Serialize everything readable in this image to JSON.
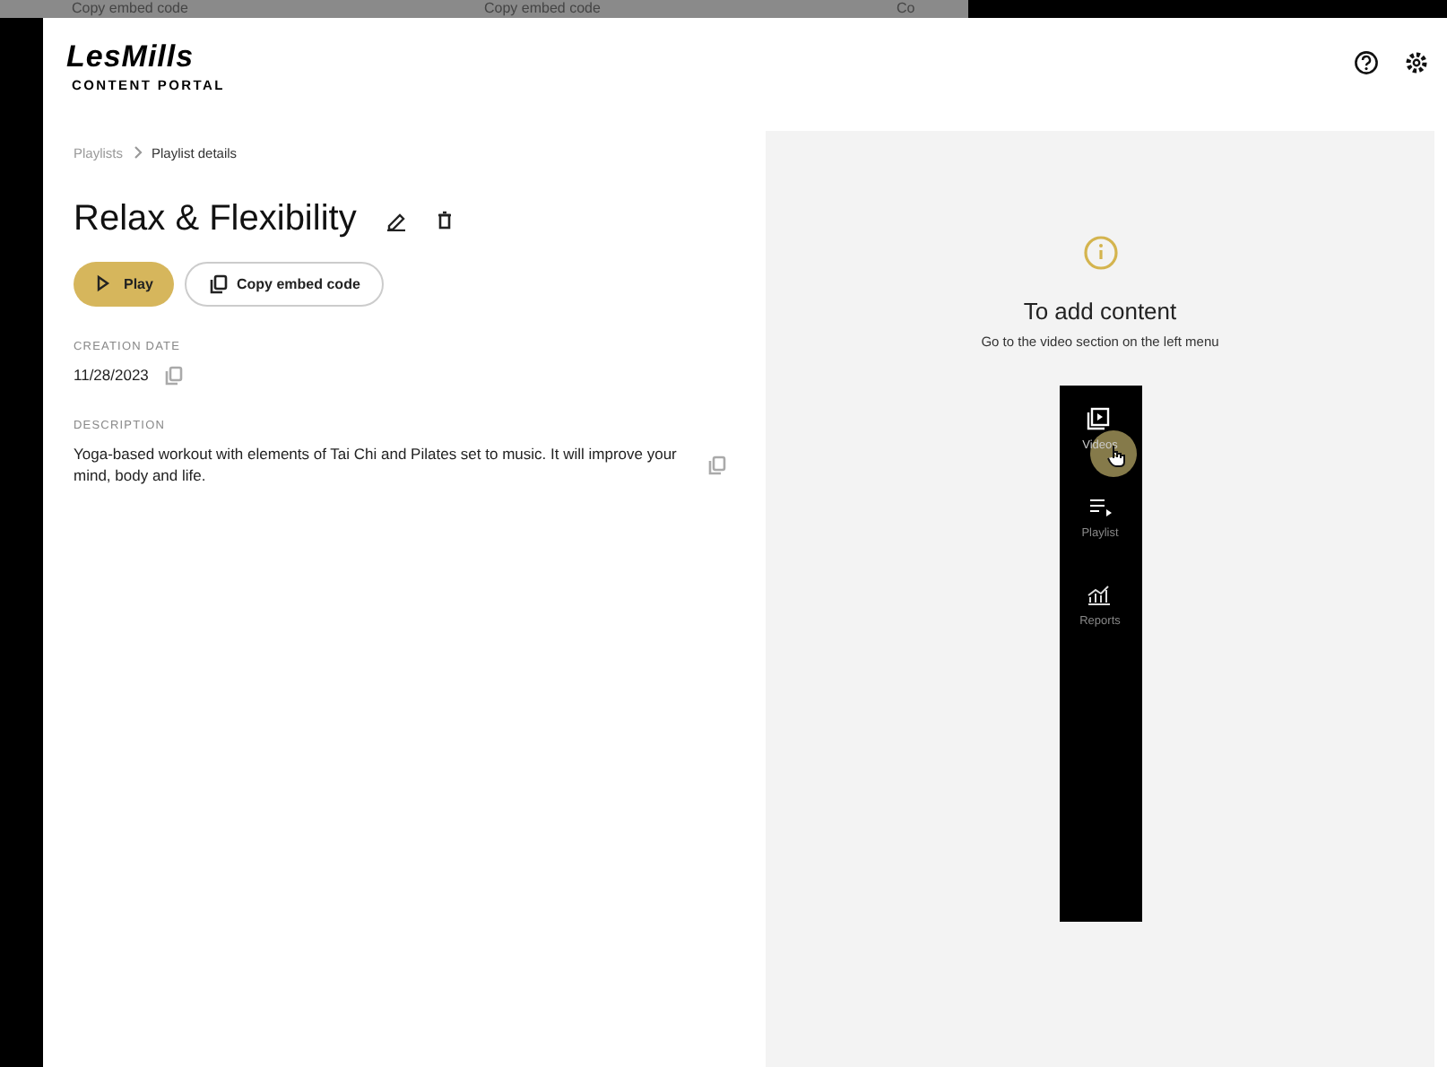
{
  "background_strip": {
    "items": [
      "Copy embed code",
      "Copy embed code",
      "Co"
    ]
  },
  "header": {
    "logo": "LesMills",
    "subtitle": "CONTENT PORTAL"
  },
  "breadcrumb": [
    {
      "label": "Playlists",
      "current": false
    },
    {
      "label": "Playlist details",
      "current": true
    }
  ],
  "playlist": {
    "title": "Relax & Flexibility",
    "buttons": [
      {
        "kind": "play",
        "label": "Play"
      },
      {
        "kind": "copy",
        "label": "Copy embed code"
      }
    ],
    "fields": [
      {
        "label": "CREATION DATE",
        "value": "11/28/2023"
      },
      {
        "label": "DESCRIPTION",
        "value": "Yoga-based workout with elements of Tai Chi and Pilates set to music. It will improve your mind, body and life."
      }
    ]
  },
  "hint": {
    "title": "To add content",
    "text": "Go to the video section on the left menu",
    "menu": [
      {
        "kind": "videos",
        "label": "Videos",
        "selected": true
      },
      {
        "kind": "playlist",
        "label": "Playlist",
        "selected": false
      },
      {
        "kind": "reports",
        "label": "Reports",
        "selected": false
      }
    ]
  }
}
